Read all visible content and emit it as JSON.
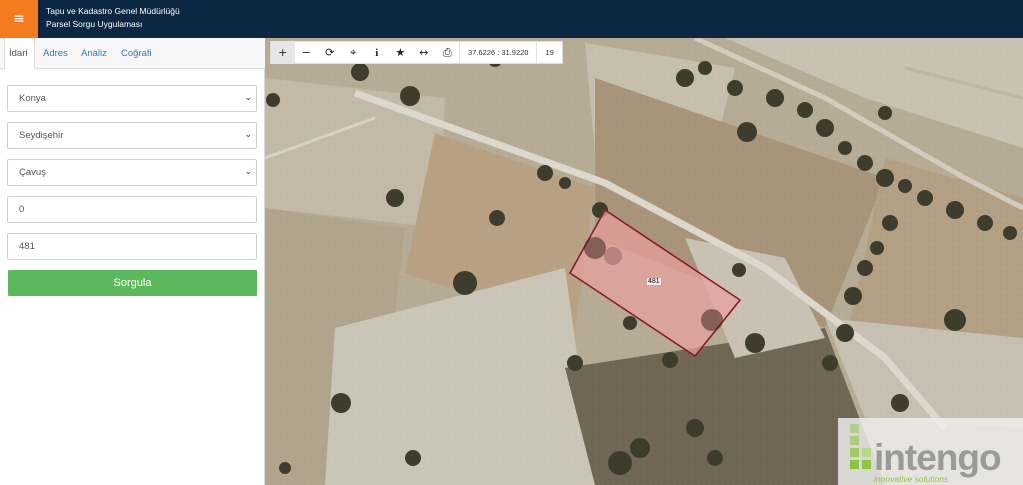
{
  "header": {
    "menu_icon": "≡",
    "title_line1": "Tapu ve Kadastro Genel Müdürlüğü",
    "title_line2": "Parsel Sorgu Uygulaması",
    "bg_color": "#0b2742",
    "menu_color": "#f47b20"
  },
  "sidebar": {
    "tabs": [
      {
        "label": "İdari",
        "active": true
      },
      {
        "label": "Adres",
        "active": false
      },
      {
        "label": "Analiz",
        "active": false
      },
      {
        "label": "Coğrafi",
        "active": false
      }
    ],
    "selects": [
      {
        "value": "Konya"
      },
      {
        "value": "Seydişehir"
      },
      {
        "value": "Çavuş"
      }
    ],
    "inputs": [
      {
        "value": "0"
      },
      {
        "value": "481"
      }
    ],
    "submit_label": "Sorgula",
    "submit_color": "#5cb85c"
  },
  "map": {
    "toolbar": {
      "icons": [
        "plus-icon",
        "minus-icon",
        "refresh-icon",
        "locate-icon",
        "info-icon",
        "star-icon",
        "measure-icon",
        "print-icon"
      ],
      "glyphs": [
        "+",
        "−",
        "⟳",
        "⌖",
        "i",
        "★",
        "↔",
        "⎙"
      ],
      "coordinates": "37.6226 : 31.9220",
      "zoom": "19"
    },
    "parcel_label": "481",
    "parcel_fill": "#e8a0a0",
    "parcel_stroke": "#8b1a2b"
  },
  "logo": {
    "name": "intengo",
    "tagline": "innovative solutions"
  }
}
